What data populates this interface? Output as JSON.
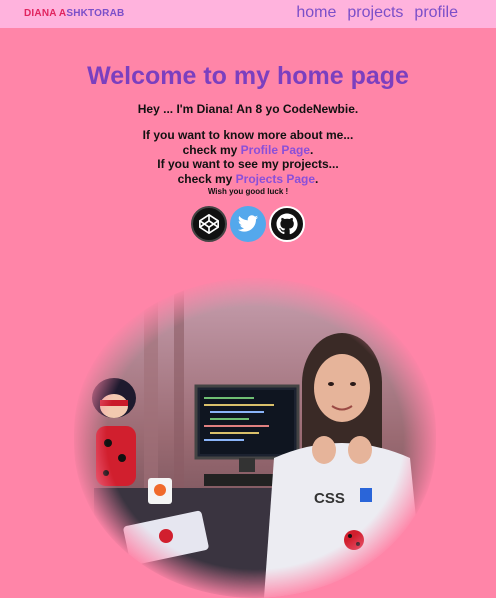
{
  "nav": {
    "brand_first": "DIANA A",
    "brand_second": "SHKTORAB",
    "links": [
      "home",
      "projects",
      "profile"
    ]
  },
  "main": {
    "title": "Welcome to my home page",
    "intro": "Hey ... I'm Diana! An 8 yo CodeNewbie.",
    "line1": "If you want to know more about me...",
    "line2_prefix": "check my ",
    "profile_link": "Profile Page",
    "line2_suffix": ".",
    "line3": "If you want to see my projects...",
    "line4_prefix": "check my ",
    "projects_link": "Projects Page",
    "line4_suffix": ".",
    "luck": "Wish you good luck !"
  },
  "socials": [
    "codepen-icon",
    "twitter-icon",
    "github-icon"
  ],
  "colors": {
    "background": "#ff85a8",
    "navbar": "#ffb3dd",
    "accent": "#7b3fbf",
    "link": "#8a4fd9"
  }
}
